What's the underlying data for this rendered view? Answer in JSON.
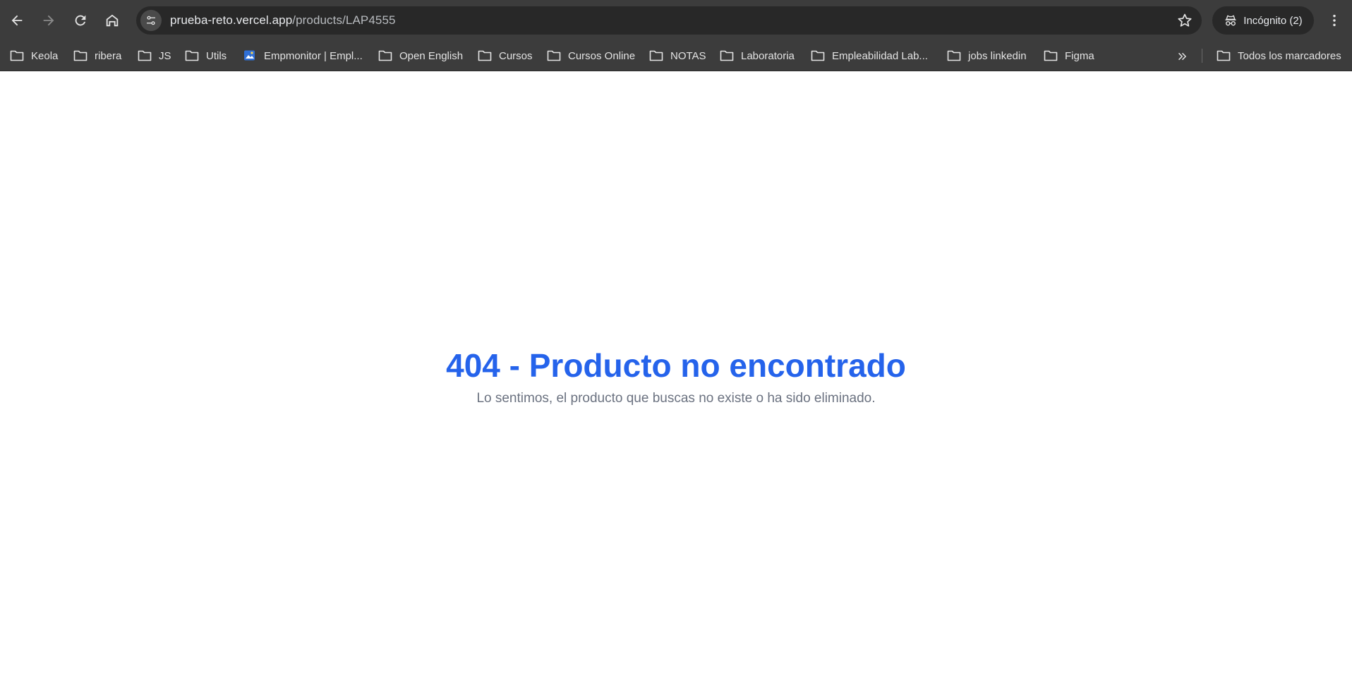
{
  "browser": {
    "url_host": "prueba-reto.vercel.app",
    "url_path": "/products/LAP4555",
    "incognito_label": "Incógnito (2)",
    "icons": {
      "back": "arrow-left-icon",
      "forward": "arrow-right-icon",
      "reload": "reload-icon",
      "home": "home-icon",
      "site_info": "tune-icon",
      "bookmark_star": "star-icon",
      "incognito": "incognito-icon",
      "menu": "kebab-menu-icon"
    }
  },
  "bookmarks": {
    "items": [
      {
        "label": "Keola",
        "icon": "folder-icon"
      },
      {
        "label": "ribera",
        "icon": "folder-icon"
      },
      {
        "label": "JS",
        "icon": "folder-icon"
      },
      {
        "label": "Utils",
        "icon": "folder-icon"
      },
      {
        "label": "Empmonitor | Empl...",
        "icon": "site-favicon"
      },
      {
        "label": "Open English",
        "icon": "folder-icon"
      },
      {
        "label": "Cursos",
        "icon": "folder-icon"
      },
      {
        "label": "Cursos Online",
        "icon": "folder-icon"
      },
      {
        "label": "NOTAS",
        "icon": "folder-icon"
      },
      {
        "label": "Laboratoria",
        "icon": "folder-icon"
      },
      {
        "label": "Empleabilidad Lab...",
        "icon": "folder-icon"
      },
      {
        "label": "jobs linkedin",
        "icon": "folder-icon"
      },
      {
        "label": "Figma",
        "icon": "folder-icon"
      }
    ],
    "all_bookmarks_label": "Todos los marcadores"
  },
  "page": {
    "title": "404 - Producto no encontrado",
    "message": "Lo sentimos, el producto que buscas no existe o ha sido eliminado.",
    "colors": {
      "title": "#2563eb",
      "message": "#6b7280"
    }
  }
}
